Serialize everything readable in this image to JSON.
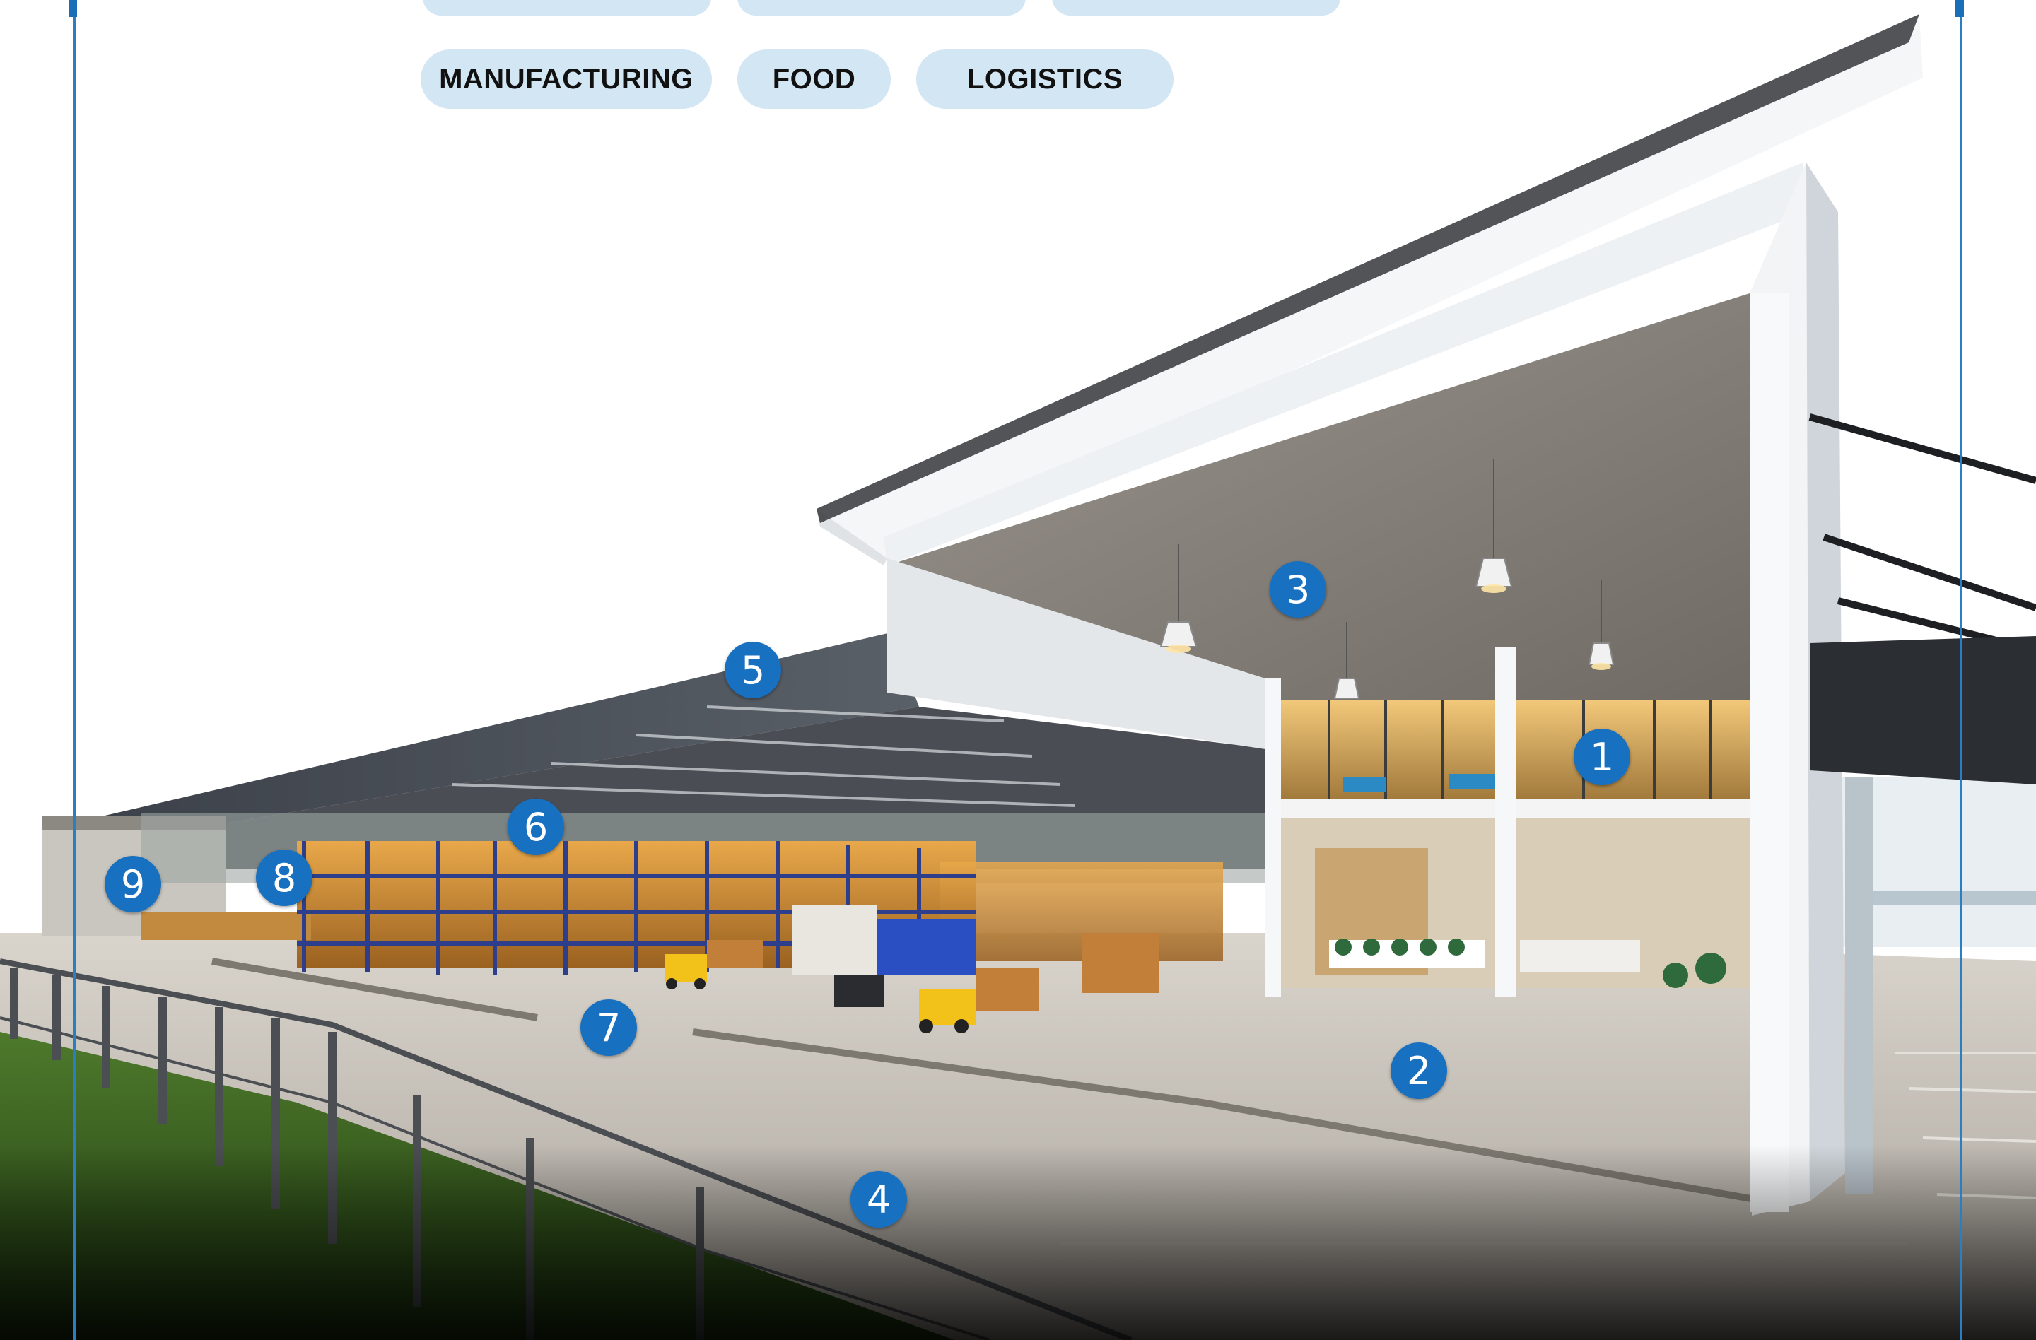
{
  "categories": {
    "pills": [
      "MANUFACTURING",
      "FOOD",
      "LOGISTICS"
    ]
  },
  "markers": {
    "m1": "1",
    "m2": "2",
    "m3": "3",
    "m4": "4",
    "m5": "5",
    "m6": "6",
    "m7": "7",
    "m8": "8",
    "m9": "9"
  },
  "colors": {
    "accent": "#1770c0",
    "pill_bg": "#d3e6f4",
    "frame_line": "#2a7ec2"
  }
}
